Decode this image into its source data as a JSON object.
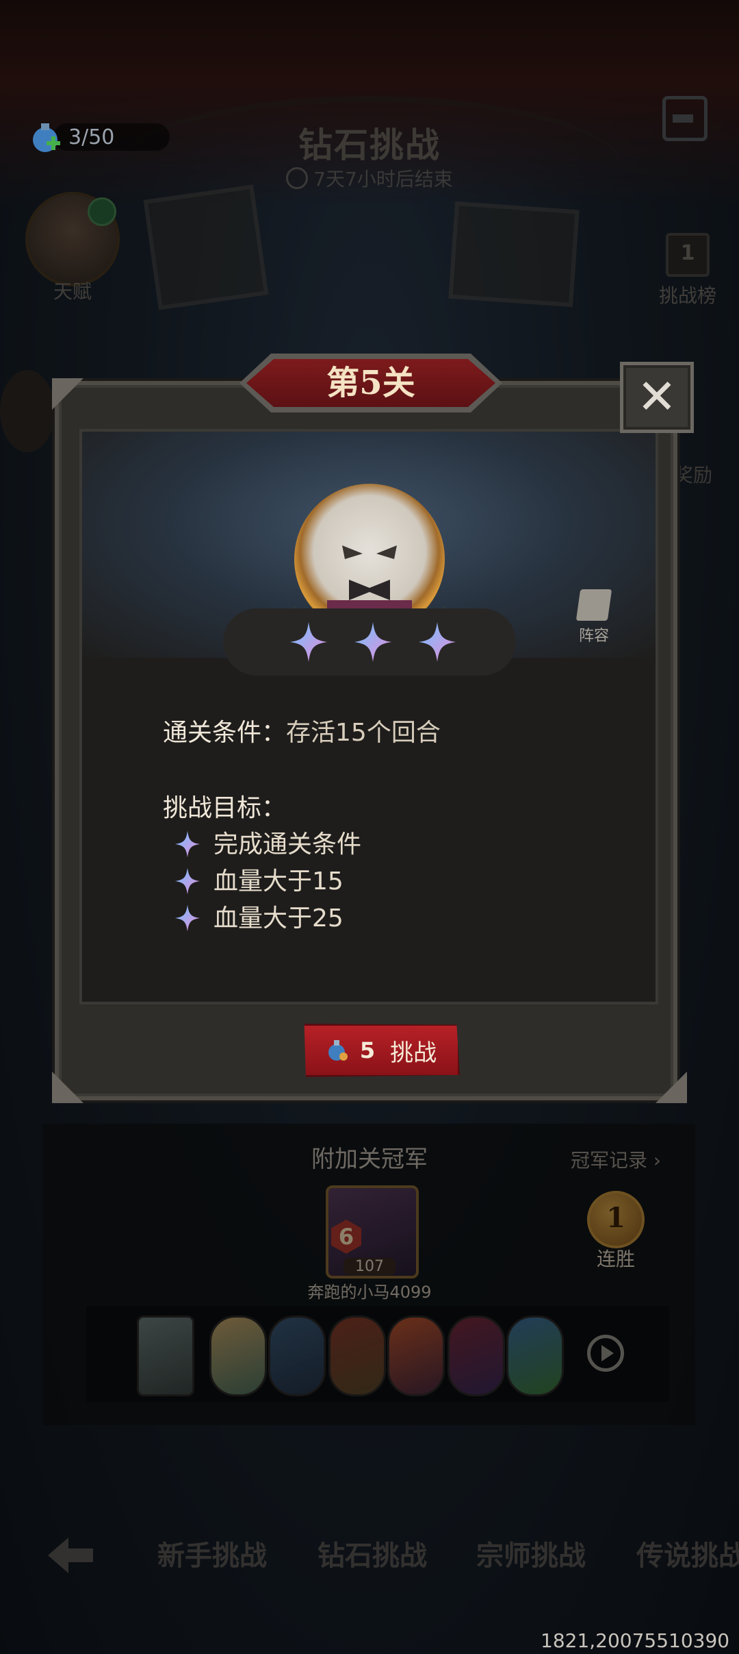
{
  "hud": {
    "energy": "3/50",
    "title": "钻石挑战",
    "countdown": "7天7小时后结束",
    "talent_label": "天赋",
    "leaderboard_label": "挑战榜",
    "leaderboard_icon_num": "1",
    "reward_label": "奖励"
  },
  "modal": {
    "level_title": "第5关",
    "close_glyph": "✕",
    "lineup_label": "阵容",
    "stars_earned": 3,
    "condition_label": "通关条件：",
    "condition_value": "存活15个回合",
    "goals_title": "挑战目标：",
    "goals": [
      "完成通关条件",
      "血量大于15",
      "血量大于25"
    ],
    "challenge_cost": "5",
    "challenge_label": "挑战"
  },
  "champion": {
    "title": "附加关冠军",
    "record_link": "冠军记录",
    "level": "6",
    "power": "107",
    "name": "奔跑的小马4099",
    "win_streak_count": "1",
    "win_streak_label": "连胜",
    "team_icons": [
      "hero-1",
      "hero-2",
      "hero-3",
      "hero-4",
      "hero-5",
      "hero-6",
      "hero-7"
    ]
  },
  "tabs": [
    "新手挑战",
    "钻石挑战",
    "宗师挑战",
    "传说挑战"
  ],
  "debug_text": "1821,20075510390",
  "colors": {
    "accent_red": "#b62126",
    "star_blue": "#6fc3ff",
    "star_pink": "#e98bd9",
    "gold": "#d99a3b"
  }
}
